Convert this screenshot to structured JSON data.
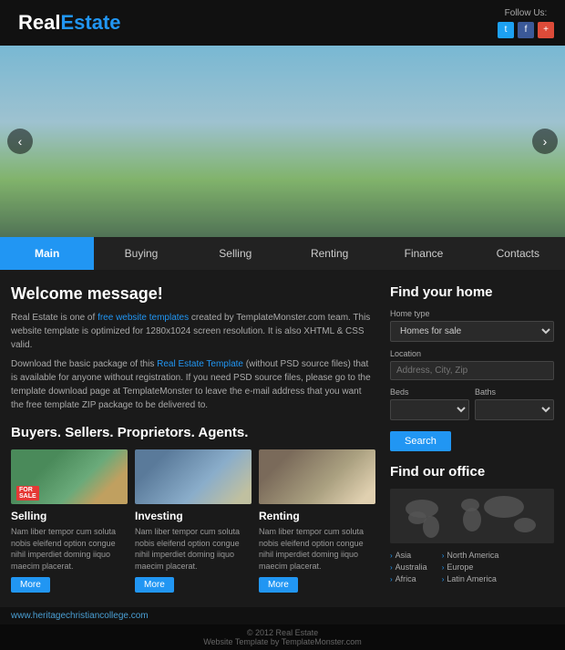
{
  "header": {
    "logo_real": "Real",
    "logo_estate": "Estate",
    "follow_label": "Follow Us:"
  },
  "social": {
    "twitter": "t",
    "facebook": "f",
    "plus": "+"
  },
  "nav": {
    "items": [
      {
        "label": "Main",
        "active": true
      },
      {
        "label": "Buying",
        "active": false
      },
      {
        "label": "Selling",
        "active": false
      },
      {
        "label": "Renting",
        "active": false
      },
      {
        "label": "Finance",
        "active": false
      },
      {
        "label": "Contacts",
        "active": false
      }
    ]
  },
  "welcome": {
    "title": "Welcome message!",
    "text1": "Real Estate is one of free website templates created by TemplateMonster.com team. This website template is optimized for 1280x1024 screen resolution. It is also XHTML & CSS valid.",
    "text2": "Download the basic package of this Real Estate Template (without PSD source files) that is available for anyone without registration. If you need PSD source files, please go to the template download page at TemplateMonster to leave the e-mail address that you want the free template ZIP package to be delivered to.",
    "link1": "free website templates",
    "link2": "Real Estate Template"
  },
  "buyers_section": {
    "title": "Buyers. Sellers. Proprietors. Agents."
  },
  "cards": [
    {
      "type": "selling",
      "title": "Selling",
      "text": "Nam liber tempor cum soluta nobis eleifend option congue nihil imperdiet doming iiquo maecim placerat.",
      "btn": "More"
    },
    {
      "type": "investing",
      "title": "Investing",
      "text": "Nam liber tempor cum soluta nobis eleifend option congue nihil imperdiet doming iiquo maecim placerat.",
      "btn": "More"
    },
    {
      "type": "renting",
      "title": "Renting",
      "text": "Nam liber tempor cum soluta nobis eleifend option congue nihil imperdiet doming iiquo maecim placerat.",
      "btn": "More"
    }
  ],
  "sidebar": {
    "find_home_title": "Find your home",
    "home_type_label": "Home type",
    "home_type_value": "Homes for sale",
    "location_label": "Location",
    "location_placeholder": "Address, City, Zip",
    "beds_label": "Beds",
    "baths_label": "Baths",
    "search_btn": "Search",
    "find_office_title": "Find our office",
    "regions": [
      {
        "name": "Asia"
      },
      {
        "name": "Australia"
      },
      {
        "name": "Africa"
      },
      {
        "name": "North America"
      },
      {
        "name": "Europe"
      },
      {
        "name": "Latin America"
      }
    ]
  },
  "footer": {
    "url": "www.heritagechristiancollege.com",
    "copy": "© 2012 Real Estate",
    "template_by": "Website Template by TemplateMonster.com"
  }
}
